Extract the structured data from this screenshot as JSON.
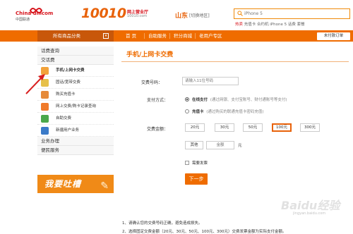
{
  "header": {
    "logo_en": "China unicom",
    "logo_cn": "中国联通",
    "brand_number": "10010",
    "brand_tagline": "网上营业厅",
    "brand_domain": "10010.com",
    "region": "山东",
    "region_switch": "[切换地区]",
    "search_placeholder": "iPhone 5",
    "hot_label": "热卖",
    "hot_links": "充值卡  合约机  iPhone 5  话费  套餐"
  },
  "nav": {
    "category_label": "所有商品分类",
    "items": [
      "首  页",
      "自助服务",
      "积分商城",
      "老用户专区"
    ],
    "orders_button": "未付款订单"
  },
  "sidebar": {
    "section_query": "话费查询",
    "section_pay": "交话费",
    "items": [
      {
        "label": "手机/上网卡交费",
        "icon": "mobile-icon",
        "color": "#f2a23a"
      },
      {
        "label": "固话/宽带交费",
        "icon": "landline-icon",
        "color": "#e6c04a"
      },
      {
        "label": "购买充值卡",
        "icon": "card-icon",
        "color": "#e68a3a"
      },
      {
        "label": "网上交费/购卡记录查询",
        "icon": "record-icon",
        "color": "#f07a2a"
      },
      {
        "label": "自助交费",
        "icon": "self-pay-icon",
        "color": "#4aa84a"
      },
      {
        "label": "新疆用户业务",
        "icon": "xinjiang-icon",
        "color": "#3a7ac8"
      }
    ],
    "section_business": "业务办理",
    "section_service": "便民服务",
    "promo_text": "我要吐槽"
  },
  "main": {
    "title": "手机/上网卡交费",
    "number_label": "交费号码：",
    "number_placeholder": "请输入11位号码",
    "method_label": "支付方式：",
    "method_online": "在线支付",
    "method_online_note": "(通过网银、支付宝账号、财付通账号等支付)",
    "method_card": "充值卡",
    "method_card_note": "(通过购买的联通充值卡密码充值)",
    "amount_label": "交费金额：",
    "amounts": [
      "20元",
      "30元",
      "50元",
      "100元",
      "300元"
    ],
    "selected_amount": "100元",
    "other_label": "其他",
    "other_placeholder": "金额",
    "other_unit": "元",
    "invoice_label": "需要发票",
    "submit_label": "下一步",
    "footnotes": [
      "1、请确认您的交费号码正确，避免造成损失。",
      "2、选择固定交费金额（20元、30元、50元、100元、300元）交费发票金额为实际支付金额。"
    ]
  },
  "watermark": {
    "text": "Baidu经验",
    "sub": "jingyan.baidu.com"
  }
}
